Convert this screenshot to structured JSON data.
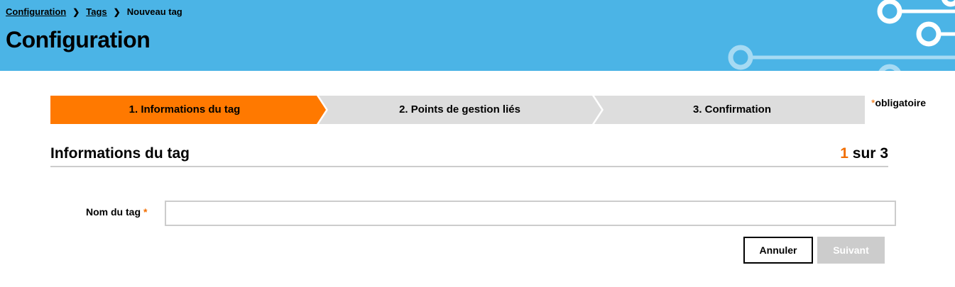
{
  "breadcrumb": {
    "items": [
      {
        "label": "Configuration"
      },
      {
        "label": "Tags"
      },
      {
        "label": "Nouveau tag"
      }
    ]
  },
  "header": {
    "title": "Configuration",
    "bg_color": "#4bb4e6"
  },
  "stepper": {
    "steps": [
      {
        "label": "1. Informations du tag",
        "active": true
      },
      {
        "label": "2. Points de gestion liés",
        "active": false
      },
      {
        "label": "3. Confirmation",
        "active": false
      }
    ],
    "active_color": "#ff7900",
    "inactive_color": "#dddddd"
  },
  "required_note": {
    "star": "*",
    "text": "obligatoire"
  },
  "section": {
    "title": "Informations du tag",
    "step_current": "1",
    "step_rest": " sur 3"
  },
  "form": {
    "tag_name": {
      "label": "Nom du tag",
      "required_mark": "*",
      "value": "",
      "placeholder": ""
    }
  },
  "buttons": {
    "cancel": "Annuler",
    "next": "Suivant"
  },
  "colors": {
    "accent": "#f16e00",
    "disabled_button": "#cccccc"
  }
}
